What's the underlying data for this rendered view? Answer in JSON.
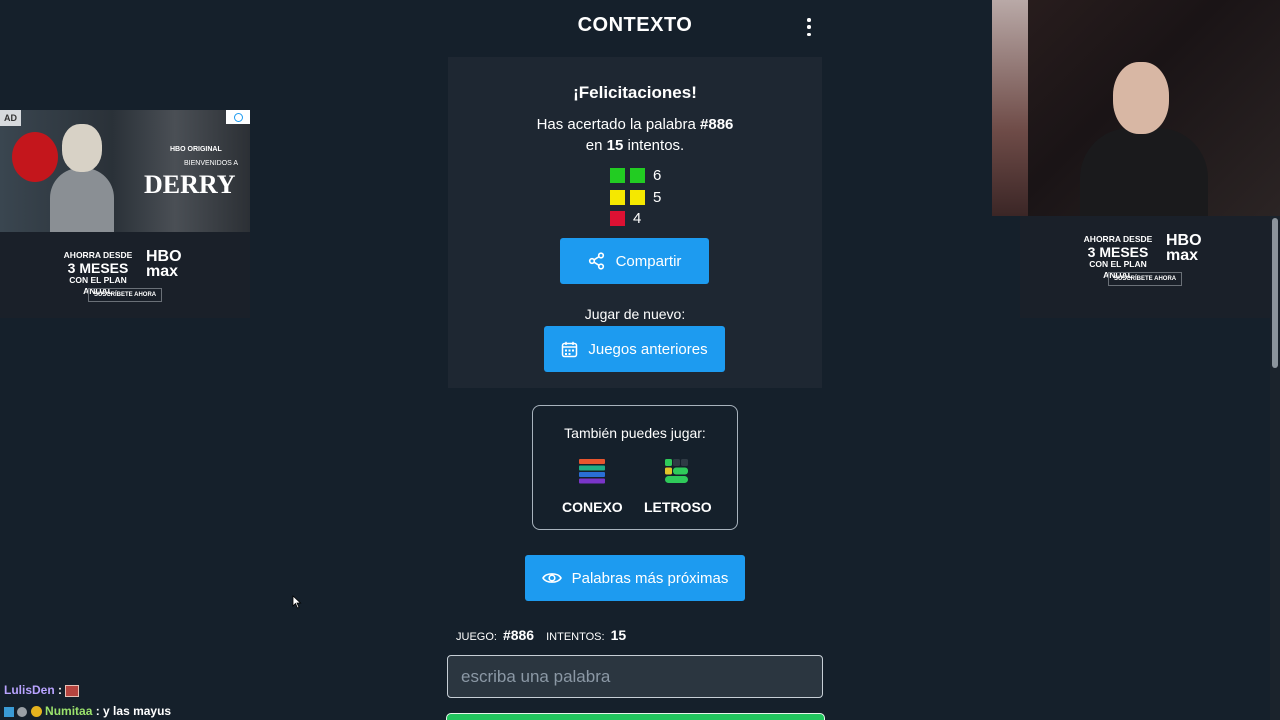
{
  "header": {
    "title": "CONTEXTO",
    "menu_icon": "kebab-menu-icon"
  },
  "result": {
    "congrats": "¡Felicitaciones!",
    "line1_pre": "Has acertado la palabra ",
    "line1_word": "#886",
    "line2_pre": "en ",
    "line2_attempts": "15",
    "line2_post": " intentos.",
    "stats": [
      {
        "color": "#22cc22",
        "squares": 2,
        "count": "6"
      },
      {
        "color": "#f5e800",
        "squares": 2,
        "count": "5"
      },
      {
        "color": "#dd1133",
        "squares": 1,
        "count": "4"
      }
    ],
    "share_label": "Compartir",
    "replay_label": "Jugar de nuevo:",
    "previous_games_label": "Juegos anteriores"
  },
  "also_play": {
    "label": "También puedes jugar:",
    "games": [
      {
        "name": "CONEXO"
      },
      {
        "name": "LETROSO"
      }
    ]
  },
  "closest_words_label": "Palabras más próximas",
  "game_info": {
    "game_label": "JUEGO:",
    "game_value": "#886",
    "attempts_label": "INTENTOS:",
    "attempts_value": "15"
  },
  "input": {
    "placeholder": "escriba una palabra"
  },
  "ads": {
    "badge": "AD",
    "tag": "HBO ORIGINAL",
    "welcome": "BIENVENIDOS A",
    "headline": "DERRY",
    "offer_top": "AHORRA DESDE",
    "offer_big": "3 MESES",
    "offer_bottom": "CON EL PLAN ANUAL",
    "brand_top": "HBO",
    "brand_bottom": "max",
    "cta": "SUSCRÍBETE AHORA"
  },
  "chat": [
    {
      "user": "LulisDen",
      "message": ""
    },
    {
      "user": "Numitaa",
      "message": "y las mayus"
    }
  ],
  "colors": {
    "background": "#15202b",
    "card": "#1e2732",
    "accent": "#1d9bf0",
    "go_button": "#22c55e"
  }
}
